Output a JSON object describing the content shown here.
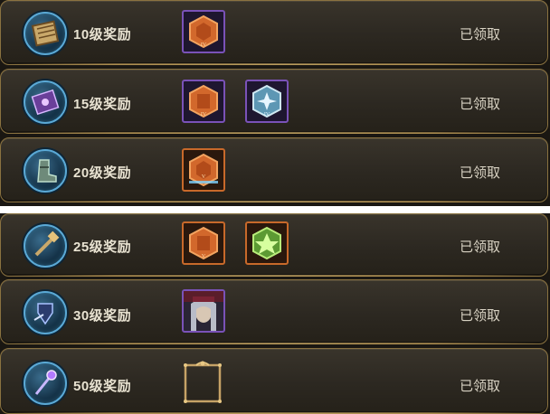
{
  "rewards": [
    {
      "label": "10级奖励",
      "status": "已领取",
      "icon": "scroll-book-icon",
      "items": [
        "orange-rune-hex-icon"
      ]
    },
    {
      "label": "15级奖励",
      "status": "已领取",
      "icon": "spellbook-icon",
      "items": [
        "orange-rune-hex-icon",
        "blue-rune-hex-icon"
      ]
    },
    {
      "label": "20级奖励",
      "status": "已领取",
      "icon": "boots-icon",
      "items": [
        "orange-rune-hex-icon"
      ]
    },
    {
      "label": "25级奖励",
      "status": "已领取",
      "icon": "hammer-icon",
      "items": [
        "orange-rune-hex-icon",
        "green-rune-hex-icon"
      ]
    },
    {
      "label": "30级奖励",
      "status": "已领取",
      "icon": "armor-icon",
      "items": [
        "hero-portrait"
      ]
    },
    {
      "label": "50级奖励",
      "status": "已领取",
      "icon": "magic-staff-icon",
      "items": [
        "avatar-frame"
      ]
    }
  ],
  "colors": {
    "accent_gold": "#c7a25b",
    "badge_blue": "#5aa9d6",
    "text": "#e9e3d2"
  }
}
